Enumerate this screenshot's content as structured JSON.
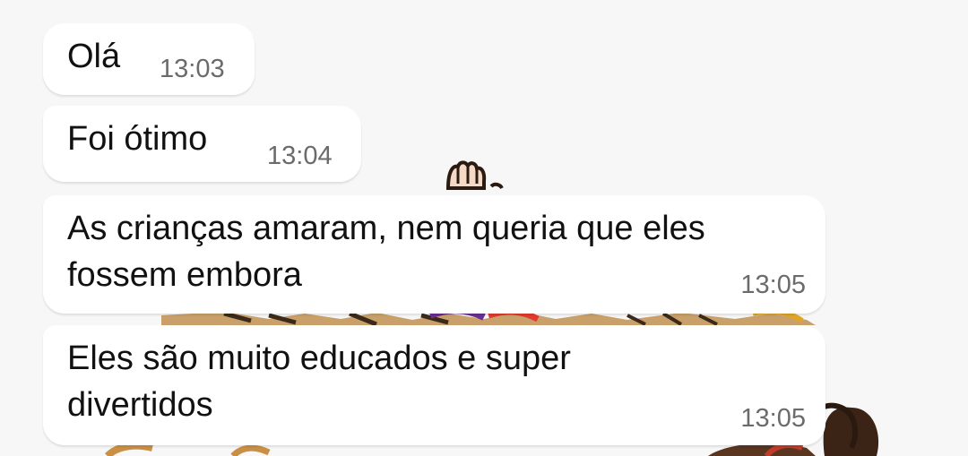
{
  "messages": [
    {
      "text": "Olá",
      "time": "13:03"
    },
    {
      "text": "Foi ótimo",
      "time": "13:04"
    },
    {
      "text": "As crianças amaram, nem queria que eles\nfossem embora",
      "time": "13:05"
    },
    {
      "text": "Eles são muito educados e super\ndivertidos",
      "time": "13:05"
    }
  ]
}
